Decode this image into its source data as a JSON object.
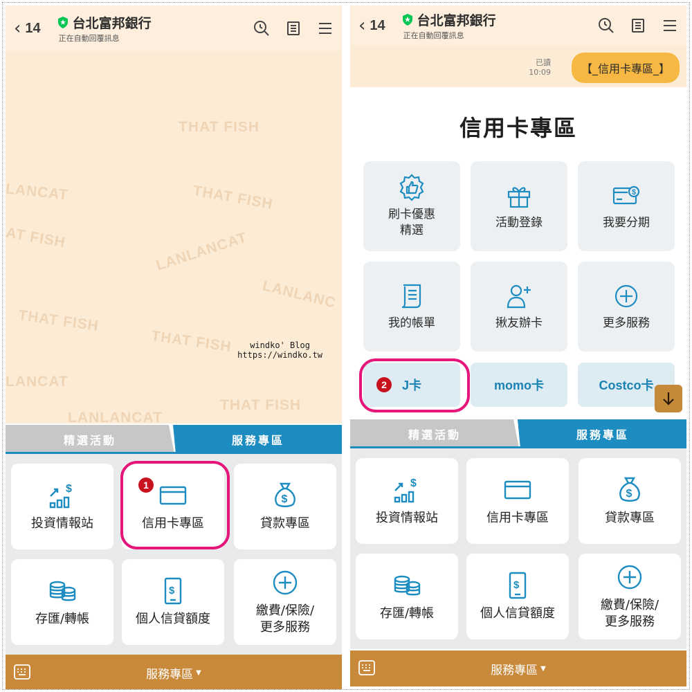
{
  "left": {
    "header": {
      "back_count": "14",
      "title": "台北富邦銀行",
      "subtitle": "正在自動回覆訊息"
    },
    "watermarks": [
      "THAT FISH",
      "LANCAT",
      "THAT FISH",
      "AT FISH",
      "LANLANCAT",
      "LANLANC",
      "THAT FISH",
      "THAT FISH",
      "LANCAT",
      "THAT FISH",
      "LANLANCAT"
    ],
    "blog": {
      "name": "windko' Blog",
      "url": "https://windko.tw"
    },
    "tabs": {
      "featured": "精選活動",
      "services": "服務專區"
    },
    "menu": [
      {
        "label": "投資情報站",
        "icon": "chart-up-dollar-icon"
      },
      {
        "label": "信用卡專區",
        "icon": "credit-card-icon"
      },
      {
        "label": "貸款專區",
        "icon": "money-bag-icon"
      },
      {
        "label": "存匯/轉帳",
        "icon": "coins-stack-icon"
      },
      {
        "label": "個人信貸額度",
        "icon": "phone-dollar-icon"
      },
      {
        "label": "繳費/保險/\n更多服務",
        "icon": "plus-circle-icon"
      }
    ],
    "bottom_bar": {
      "label": "服務專區"
    },
    "step_badge": "1"
  },
  "right": {
    "header": {
      "back_count": "14",
      "title": "台北富邦銀行",
      "subtitle": "正在自動回覆訊息"
    },
    "message": {
      "read": "已讀",
      "time": "10:09",
      "text": "【_信用卡專區_】"
    },
    "card_panel": {
      "title": "信用卡專區",
      "tiles": [
        {
          "label": "刷卡優惠\n精選",
          "icon": "thumbs-up-badge-icon"
        },
        {
          "label": "活動登錄",
          "icon": "gift-icon"
        },
        {
          "label": "我要分期",
          "icon": "card-installment-icon"
        },
        {
          "label": "我的帳單",
          "icon": "bill-icon"
        },
        {
          "label": "揪友辦卡",
          "icon": "add-friend-icon"
        },
        {
          "label": "更多服務",
          "icon": "plus-circle-icon"
        }
      ],
      "pills": [
        "J卡",
        "momo卡",
        "Costco卡"
      ]
    },
    "tabs": {
      "featured": "精選活動",
      "services": "服務專區"
    },
    "menu": [
      {
        "label": "投資情報站",
        "icon": "chart-up-dollar-icon"
      },
      {
        "label": "信用卡專區",
        "icon": "credit-card-icon"
      },
      {
        "label": "貸款專區",
        "icon": "money-bag-icon"
      },
      {
        "label": "存匯/轉帳",
        "icon": "coins-stack-icon"
      },
      {
        "label": "個人信貸額度",
        "icon": "phone-dollar-icon"
      },
      {
        "label": "繳費/保險/\n更多服務",
        "icon": "plus-circle-icon"
      }
    ],
    "bottom_bar": {
      "label": "服務專區"
    },
    "step_badge": "2"
  },
  "colors": {
    "accent_blue": "#1c8cc1",
    "highlight_pink": "#e5157a",
    "line_green": "#06c755",
    "bar_brown": "#c9893a",
    "bubble_yellow": "#f7b843"
  }
}
